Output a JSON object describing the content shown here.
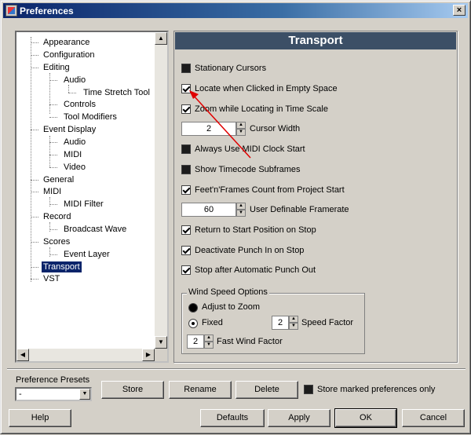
{
  "window": {
    "title": "Preferences",
    "close_glyph": "×"
  },
  "tree": {
    "items": [
      {
        "label": "Appearance"
      },
      {
        "label": "Configuration"
      },
      {
        "label": "Editing"
      },
      {
        "label": "Audio"
      },
      {
        "label": "Time Stretch Tool"
      },
      {
        "label": "Controls"
      },
      {
        "label": "Tool Modifiers"
      },
      {
        "label": "Event Display"
      },
      {
        "label": "Audio"
      },
      {
        "label": "MIDI"
      },
      {
        "label": "Video"
      },
      {
        "label": "General"
      },
      {
        "label": "MIDI"
      },
      {
        "label": "MIDI Filter"
      },
      {
        "label": "Record"
      },
      {
        "label": "Broadcast Wave"
      },
      {
        "label": "Scores"
      },
      {
        "label": "Event Layer"
      },
      {
        "label": "Transport"
      },
      {
        "label": "VST"
      }
    ],
    "selected": "Transport"
  },
  "panel": {
    "title": "Transport",
    "options": [
      {
        "label": "Stationary Cursors",
        "checked": false
      },
      {
        "label": "Locate when Clicked in Empty Space",
        "checked": true
      },
      {
        "label": "Zoom while Locating in Time Scale",
        "checked": true
      },
      {
        "label": "Cursor Width",
        "value": "2"
      },
      {
        "label": "Always Use MIDI Clock Start",
        "checked": false
      },
      {
        "label": "Show Timecode Subframes",
        "checked": false
      },
      {
        "label": "Feet'n'Frames Count from Project Start",
        "checked": true
      },
      {
        "label": "User Definable Framerate",
        "value": "60"
      },
      {
        "label": "Return to Start Position on Stop",
        "checked": true
      },
      {
        "label": "Deactivate Punch In on Stop",
        "checked": true
      },
      {
        "label": "Stop after Automatic Punch Out",
        "checked": true
      }
    ],
    "wind": {
      "legend": "Wind Speed Options",
      "adjust_label": "Adjust to Zoom",
      "fixed_label": "Fixed",
      "speed_factor_label": "Speed Factor",
      "speed_factor_value": "2",
      "fast_wind_label": "Fast Wind Factor",
      "fast_wind_value": "2",
      "selected": "Fixed"
    }
  },
  "presets": {
    "label": "Preference Presets",
    "selected": "-",
    "store": "Store",
    "rename": "Rename",
    "delete": "Delete",
    "store_marked_label": "Store marked preferences only",
    "store_marked_checked": false
  },
  "footer": {
    "help": "Help",
    "defaults": "Defaults",
    "apply": "Apply",
    "ok": "OK",
    "cancel": "Cancel"
  },
  "colors": {
    "title_bar": "#0a246a",
    "panel_header": "#3c4f66",
    "selection": "#0a246a",
    "annotation_arrow": "#e00000"
  }
}
